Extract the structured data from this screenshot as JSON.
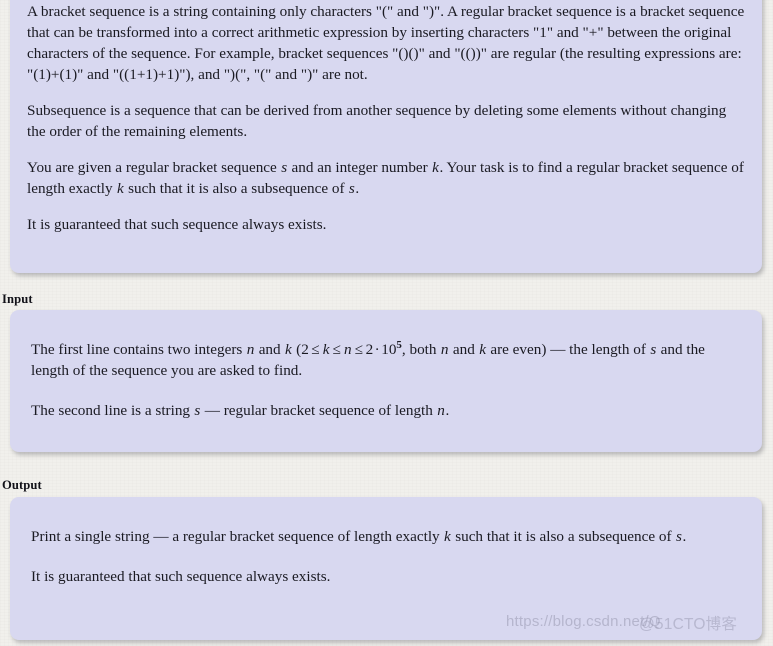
{
  "statement": {
    "paragraphs": [
      {
        "id": "definition",
        "runs": [
          {
            "t": "text",
            "v": "A bracket sequence is a string containing only characters \"(\" and \")\". A regular bracket sequence is a bracket sequence that can be transformed into a correct arithmetic expression by inserting characters \"1\" and \"+\" between the original characters of the sequence. For example, bracket sequences \"()()\" and \"(())\" are regular (the resulting expressions are: \"(1)+(1)\" and \"((1+1)+1)\"), and \")(\", \"(\" and \")\" are not."
          }
        ]
      },
      {
        "id": "subsequence-definition",
        "runs": [
          {
            "t": "text",
            "v": "Subsequence is a sequence that can be derived from another sequence by deleting some elements without changing the order of the remaining elements."
          }
        ]
      },
      {
        "id": "task",
        "runs": [
          {
            "t": "text",
            "v": "You are given a regular bracket sequence "
          },
          {
            "t": "var",
            "v": "s"
          },
          {
            "t": "text",
            "v": " and an integer number "
          },
          {
            "t": "var",
            "v": "k"
          },
          {
            "t": "text",
            "v": ". Your task is to find a regular bracket sequence of length exactly "
          },
          {
            "t": "var",
            "v": "k"
          },
          {
            "t": "text",
            "v": " such that it is also a subsequence of "
          },
          {
            "t": "var",
            "v": "s"
          },
          {
            "t": "text",
            "v": "."
          }
        ]
      },
      {
        "id": "guarantee",
        "runs": [
          {
            "t": "text",
            "v": "It is guaranteed that such sequence always exists."
          }
        ]
      }
    ]
  },
  "input": {
    "title": "Input",
    "paragraphs": [
      {
        "id": "first-line",
        "runs": [
          {
            "t": "text",
            "v": "The first line contains two integers "
          },
          {
            "t": "var",
            "v": "n"
          },
          {
            "t": "text",
            "v": " and "
          },
          {
            "t": "var",
            "v": "k"
          },
          {
            "t": "text",
            "v": " ("
          },
          {
            "t": "constraint",
            "v": "2 ≤ k ≤ n ≤ 2 · 10^5"
          },
          {
            "t": "text",
            "v": ", both "
          },
          {
            "t": "var",
            "v": "n"
          },
          {
            "t": "text",
            "v": " and "
          },
          {
            "t": "var",
            "v": "k"
          },
          {
            "t": "text",
            "v": " are even) — the length of "
          },
          {
            "t": "var",
            "v": "s"
          },
          {
            "t": "text",
            "v": " and the length of the sequence you are asked to find."
          }
        ]
      },
      {
        "id": "second-line",
        "runs": [
          {
            "t": "text",
            "v": "The second line is a string "
          },
          {
            "t": "var",
            "v": "s"
          },
          {
            "t": "text",
            "v": " — regular bracket sequence of length "
          },
          {
            "t": "var",
            "v": "n"
          },
          {
            "t": "text",
            "v": "."
          }
        ]
      }
    ]
  },
  "output": {
    "title": "Output",
    "paragraphs": [
      {
        "id": "print-line",
        "runs": [
          {
            "t": "text",
            "v": "Print a single string — a regular bracket sequence of length exactly "
          },
          {
            "t": "var",
            "v": "k"
          },
          {
            "t": "text",
            "v": " such that it is also a subsequence of "
          },
          {
            "t": "var",
            "v": "s"
          },
          {
            "t": "text",
            "v": "."
          }
        ]
      },
      {
        "id": "guarantee",
        "runs": [
          {
            "t": "text",
            "v": "It is guaranteed that such sequence always exists."
          }
        ]
      }
    ]
  },
  "constraint_formula": {
    "lower_bound": "2",
    "relation_1": "≤",
    "var_1": "k",
    "relation_2": "≤",
    "var_2": "n",
    "relation_3": "≤",
    "coefficient": "2",
    "multiplication_dot": "·",
    "base": "10",
    "exponent": "5",
    "rendered": "2 ≤ k ≤ n ≤ 2 · 10⁵"
  },
  "watermarks": {
    "csdn": "https://blog.csdn.net/Q",
    "cto": "@51CTO博客"
  },
  "colors": {
    "box_background": "#d8d8f0",
    "page_background": "#f1f0ec",
    "text": "#1a1a22",
    "heading": "#111118"
  }
}
